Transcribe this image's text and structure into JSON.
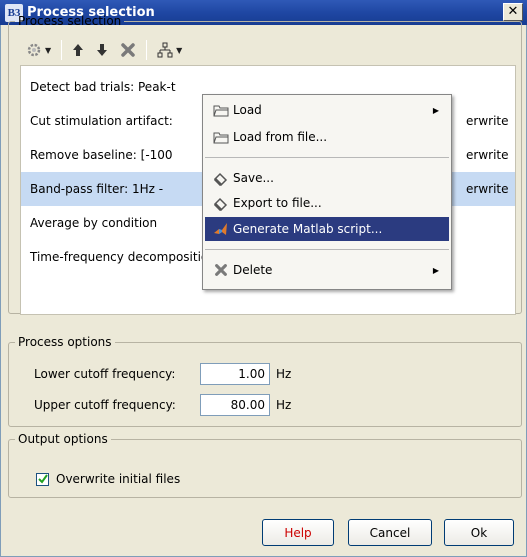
{
  "window": {
    "title": "Process selection",
    "app_icon": "B3",
    "close_glyph": "✕"
  },
  "groups": {
    "process": "Process selection",
    "options": "Process options",
    "output": "Output options"
  },
  "toolbar": {
    "icons": [
      "gear-icon",
      "arrow-up-icon",
      "arrow-down-icon",
      "delete-icon",
      "pipeline-icon"
    ]
  },
  "process_list": [
    {
      "label": "Detect bad trials: Peak-t",
      "suffix": ""
    },
    {
      "label": "Cut stimulation artifact:",
      "suffix": "erwrite"
    },
    {
      "label": "Remove baseline: [-100",
      "suffix": "erwrite"
    },
    {
      "label": "Band-pass filter: 1Hz -",
      "suffix": "erwrite",
      "selected": true
    },
    {
      "label": "Average by condition",
      "suffix": ""
    },
    {
      "label": "Time-frequency decomposition",
      "suffix": ""
    }
  ],
  "menu": {
    "items": [
      {
        "label": "Load",
        "icon": "folder-icon",
        "submenu": true
      },
      {
        "label": "Load from file...",
        "icon": "folder-icon",
        "submenu": false
      },
      {
        "label": "Save...",
        "icon": "save-icon",
        "submenu": false
      },
      {
        "label": "Export to file...",
        "icon": "save-icon",
        "submenu": false
      },
      {
        "label": "Generate Matlab script...",
        "icon": "matlab-icon",
        "submenu": false,
        "highlighted": true
      },
      {
        "label": "Delete",
        "icon": "delete-icon",
        "submenu": true
      }
    ]
  },
  "options": {
    "lower_label": "Lower cutoff frequency:",
    "lower_value": "1.00",
    "upper_label": "Upper cutoff frequency:",
    "upper_value": "80.00",
    "unit": "Hz"
  },
  "output": {
    "overwrite_label": "Overwrite initial files",
    "overwrite_checked": true
  },
  "buttons": {
    "help": "Help",
    "cancel": "Cancel",
    "ok": "Ok"
  },
  "colors": {
    "titlebar": "#1f47a3",
    "selection": "#c6daf3",
    "menu_highlight": "#2b3b80",
    "help_text": "#cc0000"
  }
}
